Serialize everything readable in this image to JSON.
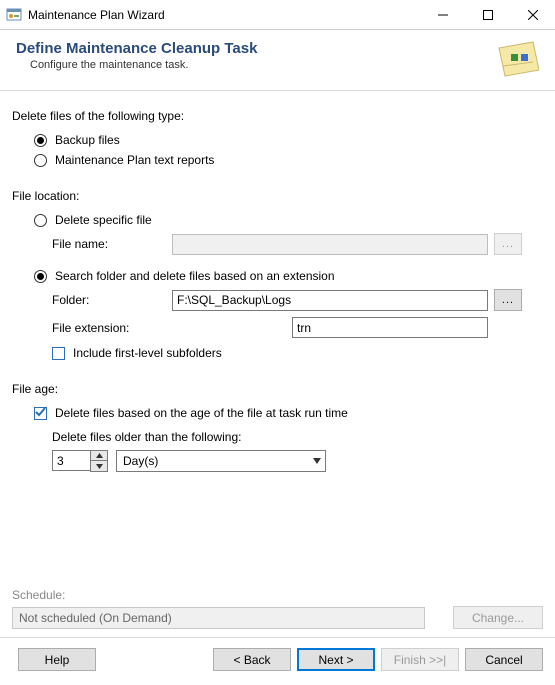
{
  "window": {
    "title": "Maintenance Plan Wizard"
  },
  "header": {
    "title": "Define Maintenance Cleanup Task",
    "subtitle": "Configure the maintenance task."
  },
  "type_section": {
    "label": "Delete files of the following type:",
    "backup_label": "Backup files",
    "report_label": "Maintenance Plan text reports"
  },
  "location_section": {
    "label": "File location:",
    "specific_label": "Delete specific file",
    "filename_label": "File name:",
    "filename_value": "",
    "browse1_label": "...",
    "search_label": "Search folder and delete files based on an extension",
    "folder_label": "Folder:",
    "folder_value": "F:\\SQL_Backup\\Logs",
    "browse2_label": "...",
    "ext_label": "File extension:",
    "ext_value": "trn",
    "subfolders_label": "Include first-level subfolders"
  },
  "age_section": {
    "label": "File age:",
    "delete_by_age_label": "Delete files based on the age of the file at task run time",
    "older_than_label": "Delete files older than the following:",
    "number_value": "3",
    "unit_value": "Day(s)"
  },
  "schedule": {
    "label": "Schedule:",
    "value": "Not scheduled (On Demand)",
    "change_label": "Change..."
  },
  "footer": {
    "help": "Help",
    "back": "< Back",
    "next": "Next >",
    "finish": "Finish >>|",
    "cancel": "Cancel"
  }
}
